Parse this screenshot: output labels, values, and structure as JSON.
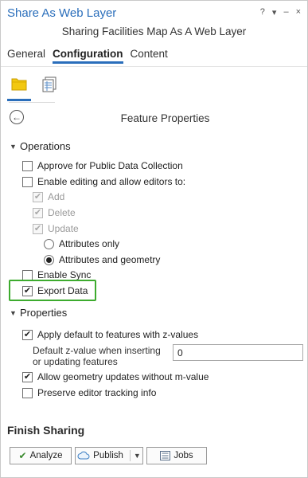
{
  "window": {
    "title": "Share As Web Layer",
    "controls": {
      "help": "?",
      "dropdown": "▾",
      "minimize": "–",
      "close": "×"
    },
    "subtitle": "Sharing Facilities Map As A Web Layer"
  },
  "tabs": [
    {
      "label": "General",
      "active": false
    },
    {
      "label": "Configuration",
      "active": true
    },
    {
      "label": "Content",
      "active": false
    }
  ],
  "subtabs": [
    {
      "icon": "layers-folder-icon",
      "active": true
    },
    {
      "icon": "feature-table-icon",
      "active": false
    }
  ],
  "panel": {
    "back_glyph": "←",
    "title": "Feature Properties"
  },
  "operations": {
    "header": "Operations",
    "approve_public": {
      "label": "Approve for Public Data Collection",
      "checked": false
    },
    "enable_editing": {
      "label": "Enable editing and allow editors to:",
      "checked": false
    },
    "add": {
      "label": "Add",
      "checked": true,
      "enabled": false
    },
    "delete": {
      "label": "Delete",
      "checked": true,
      "enabled": false
    },
    "update": {
      "label": "Update",
      "checked": true,
      "enabled": false
    },
    "attributes_only": {
      "label": "Attributes only",
      "selected": false
    },
    "attributes_geometry": {
      "label": "Attributes and geometry",
      "selected": true
    },
    "enable_sync": {
      "label": "Enable Sync",
      "checked": false
    },
    "export_data": {
      "label": "Export Data",
      "checked": true
    }
  },
  "properties": {
    "header": "Properties",
    "apply_default_z": {
      "label": "Apply default to features with z-values",
      "checked": true
    },
    "default_z_label": "Default z-value when inserting or updating features",
    "default_z_value": "0",
    "allow_geometry_updates": {
      "label": "Allow geometry updates without m-value",
      "checked": true
    },
    "preserve_tracking": {
      "label": "Preserve editor tracking info",
      "checked": false
    }
  },
  "finish": {
    "header": "Finish Sharing",
    "analyze_label": "Analyze",
    "publish_label": "Publish",
    "jobs_label": "Jobs"
  },
  "colors": {
    "accent": "#2a6ebb",
    "highlight_box": "#3dab2e",
    "folder_icon": "#f2c811"
  }
}
